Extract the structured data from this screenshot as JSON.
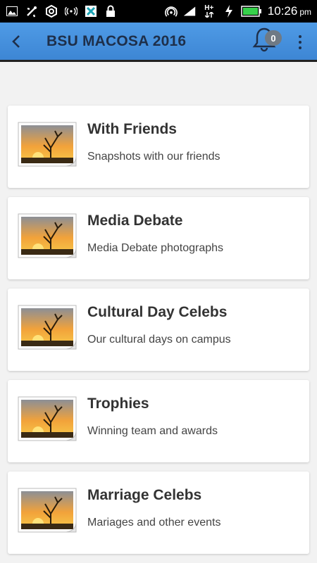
{
  "status_bar": {
    "time": "10:26",
    "ampm": "pm",
    "network_label": "H+",
    "icons": [
      "image-icon",
      "usb-icon",
      "sync-icon",
      "broadcast-icon",
      "app-icon",
      "lock-icon",
      "hotspot-icon",
      "signal-icon",
      "data-icon",
      "charging-icon",
      "battery-icon"
    ]
  },
  "app_bar": {
    "title": "BSU MACOSA 2016",
    "notification_count": "0",
    "colors": {
      "bar_top": "#4f9be6",
      "bar_bottom": "#3d86d4",
      "title": "#1e2f4a"
    }
  },
  "albums": [
    {
      "title": "With Friends",
      "subtitle": "Snapshots with our friends"
    },
    {
      "title": "Media Debate",
      "subtitle": "Media Debate photographs"
    },
    {
      "title": "Cultural Day Celebs",
      "subtitle": "Our cultural days on campus"
    },
    {
      "title": "Trophies",
      "subtitle": "Winning team and awards"
    },
    {
      "title": "Marriage Celebs",
      "subtitle": "Mariages and other events"
    }
  ]
}
